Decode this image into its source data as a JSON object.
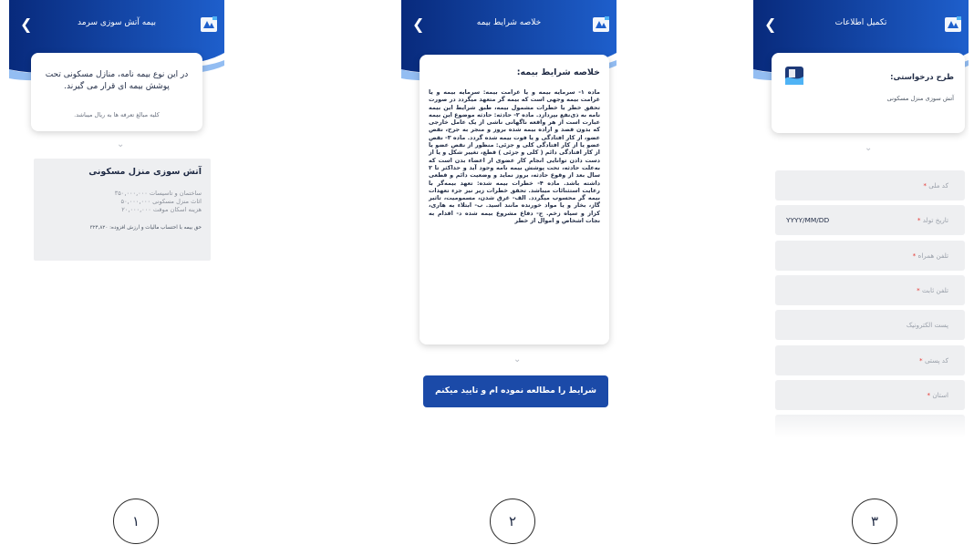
{
  "screens": [
    {
      "header_title": "بیمه آتش سوزی سرمد",
      "back_icon": "chevron-left-icon",
      "info_card": {
        "main_text": "در این نوع بیمه نامه، منازل مسکونی تحت پوشش بیمه ای قرار می گیرند.",
        "note": "کلیه مبالغ تعرفه ها به ریال میباشد."
      },
      "plan": {
        "title": "آتش سوزی منزل مسکونی",
        "rows": [
          "ساختمان و تاسیسات ۳۵۰,۰۰۰,۰۰۰",
          "اثاث منزل مسکونی ۵۰,۰۰۰,۰۰۰",
          "هزینه اسکان موقت ۲۰,۰۰۰,۰۰۰"
        ],
        "total": "حق بیمه با احتساب مالیات و ارزش افزوده: ۳۲۴,۸۲۰"
      }
    },
    {
      "header_title": "خلاصه شرایط بیمه",
      "back_icon": "chevron-left-icon",
      "terms": {
        "title": "خلاصه شرایط بیمه:",
        "body": "ماده ۱- سرمایه بیمه و یا غرامت بیمه: سرمایه بیمه و یا غرامت بیمه وجهی است که بیمه گر متعهد میگردد در صورت تحقق خطر یا خطرات مشمول بیمه، طبق شرایط این بیمه نامه به ذی‌نفع بپردازد. ماده ۲- حادثه: حادثه موضوع این بیمه عبارت است از هر واقعه ناگهانی ناشی از یک عامل خارجی که بدون قصد و اراده بیمه شده بروز و منجر به جرح، نقص عضو، از کار افتادگی و یا فوت بیمه شده گردد. ماده ۳- نقص عضو یا از کار افتادگی کلی و جزئی: منظور از نقص عضو یا از کار افتادگی دائم ( کلی و جزئی ) قطع، تغییر شکل و یا از دست دادن توانایی انجام کار عضوی از اعضاء بدن است که به‌علت حادثه، تحت پوشش بیمه نامه وجود آید و حداکثر تا ۲ سال بعد از وقوع حادثه، بروز نماید و وضعیت دائم و قطعی داشته باشد. ماده ۴- خطرات بیمه شده: تعهد بیمه‌گر با رعایت استثنائات میباشد. تحقق خطرات زیر نیز جزء تعهدات بیمه گر محسوب میگردد. الف- غرق شدن، مسمومیت، تاثیر گاز، بخار و یا مواد خورنده مانند اسید. ب- ابتلاء به هاری، کزاز و سیاه زخم. ج- دفاع مشروع بیمه شده د- اقدام به نجات اشخاص و اموال از خطر"
      },
      "confirm_button": "شرایط را مطالعه نموده ام و تایید میکنم"
    },
    {
      "header_title": "تکمیل اطلاعات",
      "back_icon": "chevron-left-icon",
      "plan_card": {
        "label": "طرح درخواستی:",
        "value": "آتش سوزی منزل مسکونی"
      },
      "fields": [
        {
          "label": "کد ملی",
          "required": "*",
          "value": ""
        },
        {
          "label": "تاریخ تولد",
          "required": "*",
          "value": "YYYY/MM/DD"
        },
        {
          "label": "تلفن همراه",
          "required": "*",
          "value": ""
        },
        {
          "label": "تلفن ثابت",
          "required": "*",
          "value": ""
        },
        {
          "label": "پست الکترونیک",
          "required": "",
          "value": ""
        },
        {
          "label": "کد پستی",
          "required": "*",
          "value": ""
        },
        {
          "label": "استان",
          "required": "*",
          "value": ""
        }
      ]
    }
  ],
  "steps": [
    "۱",
    "۲",
    "۳"
  ],
  "colors": {
    "header_dark": "#0b2f8a",
    "header_light": "#2a6fd6",
    "button": "#1b4aa8",
    "field_bg": "#eeeff1",
    "required": "#e53935"
  }
}
